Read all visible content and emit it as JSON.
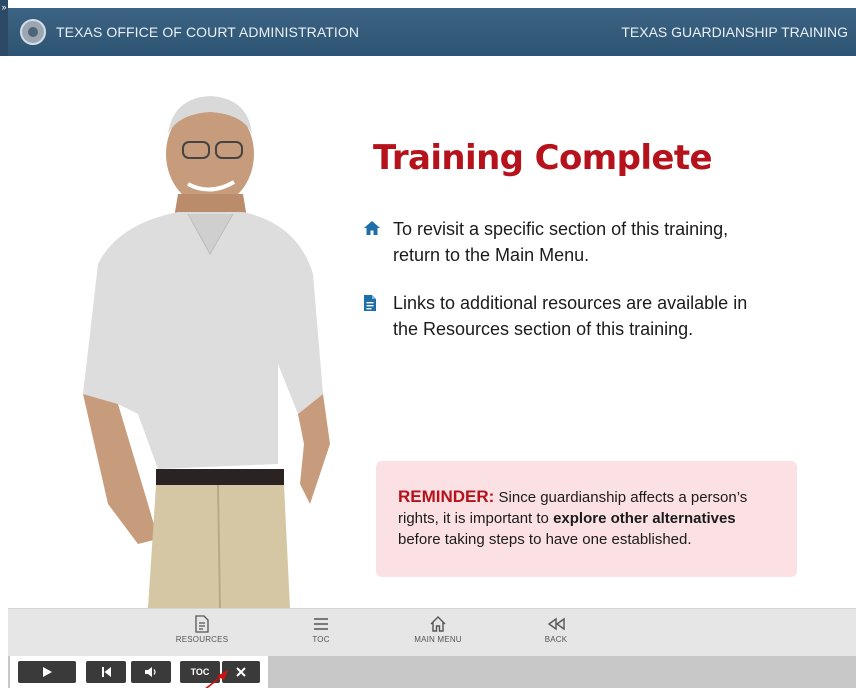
{
  "header": {
    "org_title": "TEXAS OFFICE OF COURT ADMINISTRATION",
    "course_title": "TEXAS GUARDIANSHIP TRAINING",
    "expand_glyph": "»"
  },
  "slide": {
    "heading": "Training Complete",
    "bullets": [
      {
        "icon": "home-icon",
        "text": "To revisit a specific section of this training, return to the Main Menu."
      },
      {
        "icon": "document-icon",
        "text": "Links to additional resources are available in the Resources section of this training."
      }
    ],
    "reminder": {
      "lead": "REMINDER:",
      "text_before": "Since guardianship affects a person’s rights, it is important to",
      "emphasis": "explore other alternatives",
      "text_after": "before taking steps to have one established."
    }
  },
  "nav": {
    "resources": "RESOURCES",
    "toc": "TOC",
    "main_menu": "MAIN MENU",
    "back": "BACK"
  },
  "controls": {
    "toc_label": "TOC"
  },
  "colors": {
    "header_bg": "#2e5473",
    "heading_red": "#b5121b",
    "icon_blue": "#1d6fa8",
    "reminder_bg": "#fbe1e3"
  }
}
